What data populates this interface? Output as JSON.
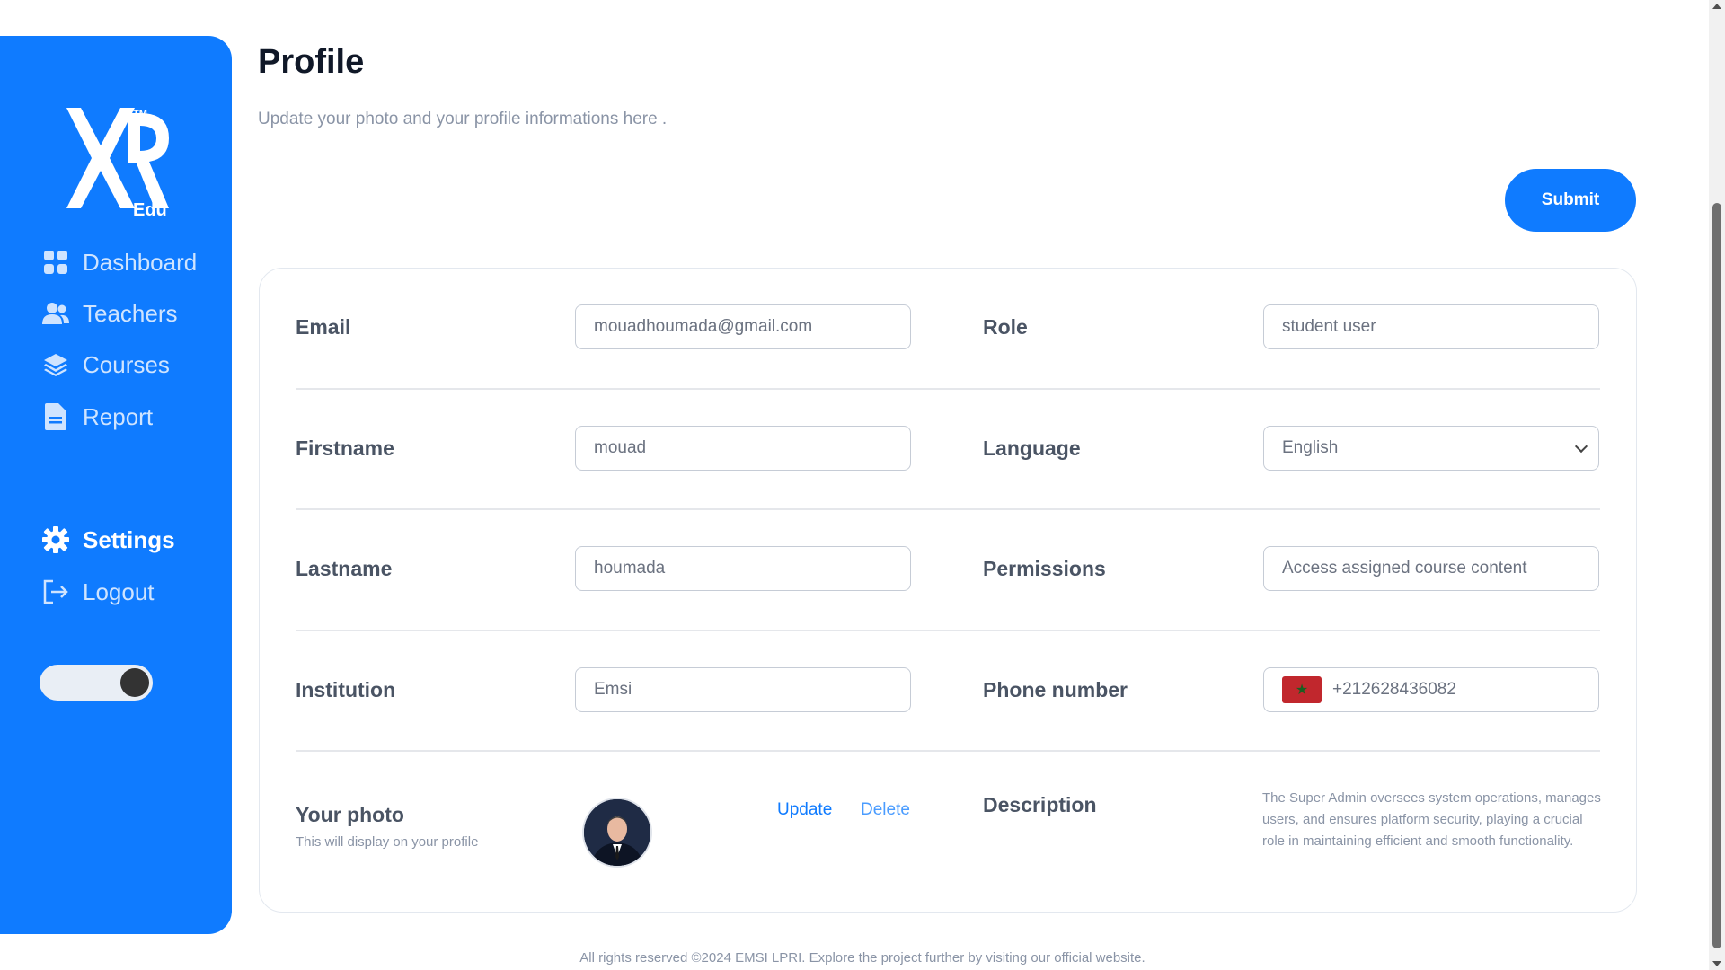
{
  "colors": {
    "accent": "#0F7BFF",
    "title": "#101828",
    "muted": "#8a94a6",
    "link": "#0F7BFF"
  },
  "sidebar": {
    "logo": {
      "brand": "XR",
      "tm": "TM",
      "sub": "Edu"
    },
    "items": [
      {
        "label": "Dashboard",
        "icon": "dashboard-grid-icon"
      },
      {
        "label": "Teachers",
        "icon": "users-icon"
      },
      {
        "label": "Courses",
        "icon": "layers-icon"
      },
      {
        "label": "Report",
        "icon": "document-icon"
      }
    ],
    "settings": {
      "label": "Settings",
      "icon": "gear-icon"
    },
    "logout": {
      "label": "Logout",
      "icon": "logout-icon"
    },
    "theme_toggle": {
      "state": "on"
    }
  },
  "header": {
    "title": "Profile",
    "subtitle": "Update your photo and your profile informations here .",
    "submit_label": "Submit"
  },
  "form": {
    "email": {
      "label": "Email",
      "value": "mouadhoumada@gmail.com"
    },
    "role": {
      "label": "Role",
      "value": "student user"
    },
    "firstname": {
      "label": "Firstname",
      "value": "mouad"
    },
    "language": {
      "label": "Language",
      "value": "English"
    },
    "lastname": {
      "label": "Lastname",
      "value": "houmada"
    },
    "permissions": {
      "label": "Permissions",
      "value": "Access assigned course content"
    },
    "institution": {
      "label": "Institution",
      "value": "Emsi"
    },
    "phone": {
      "label": "Phone number",
      "value": "+212628436082",
      "flag": "morocco-flag-icon"
    },
    "photo": {
      "label": "Your photo",
      "sub": "This will display on your profile",
      "update": "Update",
      "delete": "Delete"
    },
    "description": {
      "label": "Description",
      "text": "The Super Admin oversees system operations, manages users, and ensures platform security, playing a crucial role in maintaining efficient and smooth functionality."
    }
  },
  "footer": {
    "text": "All rights reserved ©2024 EMSI LPRI. Explore the project further by visiting our official website."
  }
}
